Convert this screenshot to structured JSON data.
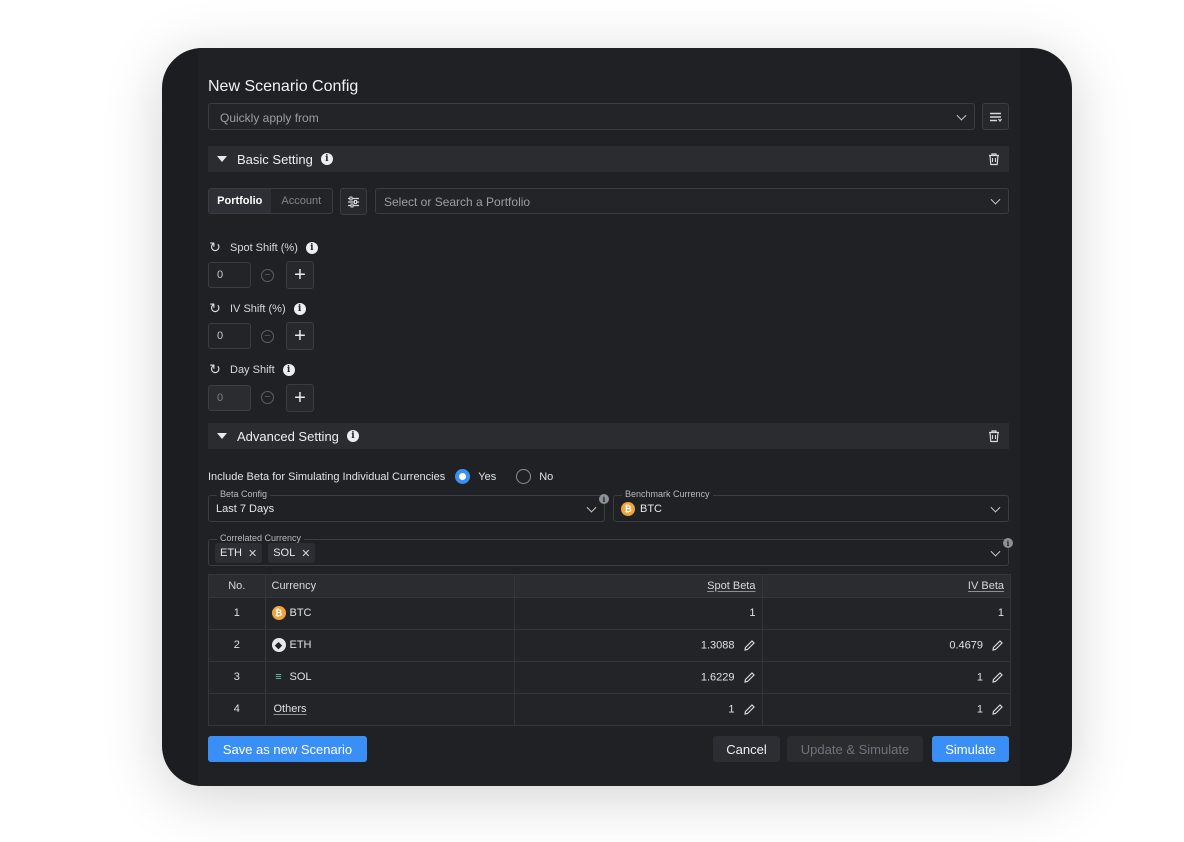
{
  "header": {
    "title": "New Scenario Config"
  },
  "quick_apply": {
    "placeholder": "Quickly apply from"
  },
  "basic": {
    "label": "Basic Setting",
    "mode_tabs": [
      "Portfolio",
      "Account"
    ],
    "portfolio_placeholder": "Select or Search a Portfolio",
    "shifts": [
      {
        "label": "Spot Shift (%)",
        "value": "0",
        "disabled": false
      },
      {
        "label": "IV Shift (%)",
        "value": "0",
        "disabled": false
      },
      {
        "label": "Day Shift",
        "value": "0",
        "disabled": true
      }
    ]
  },
  "advanced": {
    "label": "Advanced Setting",
    "beta_question": "Include Beta for Simulating Individual Currencies",
    "yes_label": "Yes",
    "no_label": "No",
    "selected": "Yes",
    "beta_config": {
      "label": "Beta Config",
      "value": "Last 7 Days"
    },
    "benchmark": {
      "label": "Benchmark Currency",
      "value": "BTC"
    },
    "correlated": {
      "label": "Correlated Currency",
      "chips": [
        "ETH",
        "SOL"
      ]
    }
  },
  "table": {
    "headers": {
      "no": "No.",
      "currency": "Currency",
      "spot_beta": "Spot Beta",
      "iv_beta": "IV Beta"
    },
    "rows": [
      {
        "no": "1",
        "currency": "BTC",
        "icon": "btc-icon",
        "spot_beta": "1",
        "iv_beta": "1",
        "editable": false
      },
      {
        "no": "2",
        "currency": "ETH",
        "icon": "eth-icon",
        "spot_beta": "1.3088",
        "iv_beta": "0.4679",
        "editable": true
      },
      {
        "no": "3",
        "currency": "SOL",
        "icon": "sol-icon",
        "spot_beta": "1.6229",
        "iv_beta": "1",
        "editable": true
      },
      {
        "no": "4",
        "currency": "Others",
        "icon": "",
        "spot_beta": "1",
        "iv_beta": "1",
        "editable": true
      }
    ]
  },
  "footer": {
    "save_label": "Save as new Scenario",
    "cancel_label": "Cancel",
    "update_label": "Update & Simulate",
    "simulate_label": "Simulate"
  },
  "colors": {
    "accent": "#3a8ff7",
    "btc": "#f2a33a",
    "background": "#1f2124"
  }
}
